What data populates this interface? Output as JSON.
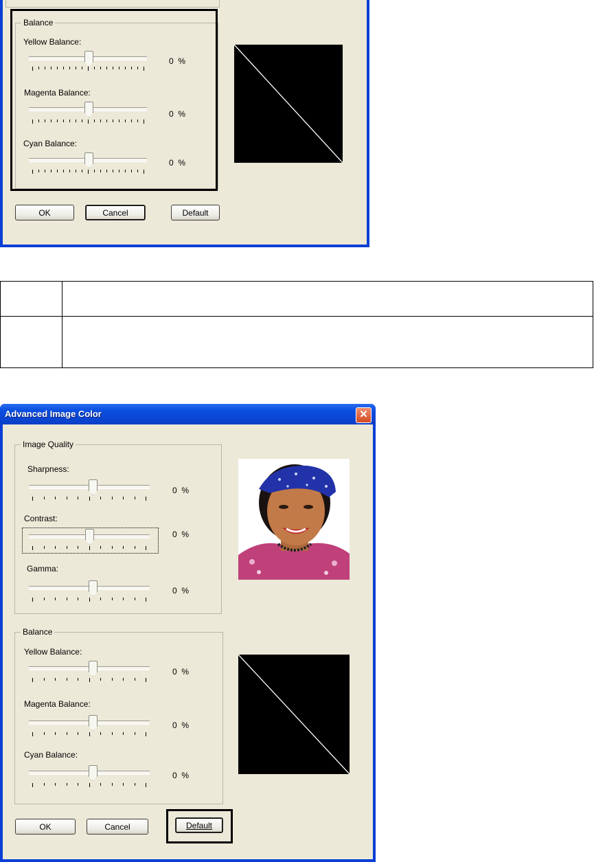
{
  "top_dialog": {
    "balance_group": {
      "legend": "Balance",
      "sliders": [
        {
          "label": "Yellow Balance:",
          "value": "0",
          "unit": "%"
        },
        {
          "label": "Magenta Balance:",
          "value": "0",
          "unit": "%"
        },
        {
          "label": "Cyan Balance:",
          "value": "0",
          "unit": "%"
        }
      ]
    },
    "buttons": {
      "ok": "OK",
      "cancel": "Cancel",
      "default": "Default"
    }
  },
  "table": {
    "rows": [
      {
        "col1": "",
        "col2": ""
      },
      {
        "col1": "",
        "col2": ""
      }
    ]
  },
  "bottom_dialog": {
    "title": "Advanced Image Color",
    "close_glyph": "✕",
    "image_quality_group": {
      "legend": "Image Quality",
      "sliders": [
        {
          "label": "Sharpness:",
          "value": "0",
          "unit": "%"
        },
        {
          "label": "Contrast:",
          "value": "0",
          "unit": "%"
        },
        {
          "label": "Gamma:",
          "value": "0",
          "unit": "%"
        }
      ]
    },
    "balance_group": {
      "legend": "Balance",
      "sliders": [
        {
          "label": "Yellow Balance:",
          "value": "0",
          "unit": "%"
        },
        {
          "label": "Magenta Balance:",
          "value": "0",
          "unit": "%"
        },
        {
          "label": "Cyan Balance:",
          "value": "0",
          "unit": "%"
        }
      ]
    },
    "buttons": {
      "ok": "OK",
      "cancel": "Cancel",
      "default": "Default"
    }
  },
  "colors": {
    "titlebar": "#0a4fe0",
    "dialog_bg": "#ece9d8",
    "curve_bg": "#000000",
    "curve_line": "#ffffff"
  }
}
